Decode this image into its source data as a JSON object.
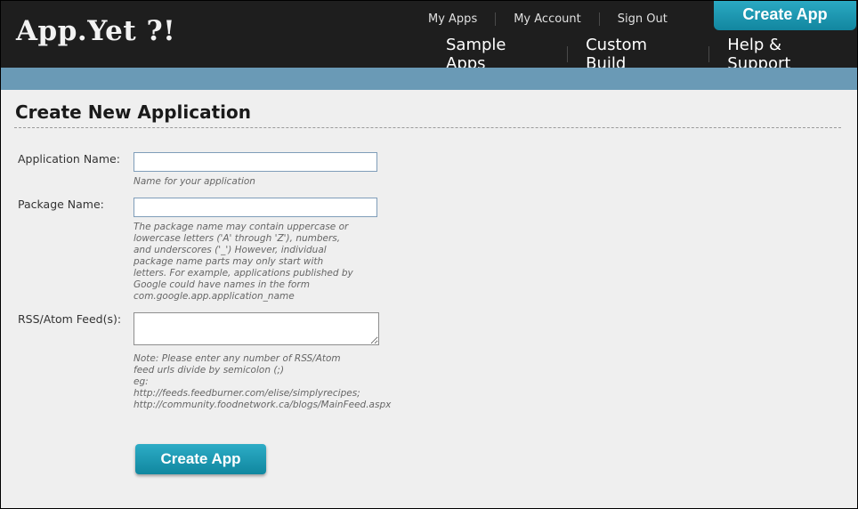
{
  "header": {
    "logo": "App.Yet ?!",
    "top_links": [
      "My Apps",
      "My Account",
      "Sign Out"
    ],
    "create_app_label": "Create App",
    "main_links": [
      "Sample Apps",
      "Custom Build",
      "Help & Support"
    ]
  },
  "page": {
    "title": "Create New Application"
  },
  "form": {
    "app_name": {
      "label": "Application Name:",
      "value": "",
      "hint": "Name for your application"
    },
    "package_name": {
      "label": "Package Name:",
      "value": "",
      "hint": "The package name may contain uppercase or\nlowercase letters ('A' through 'Z'), numbers,\nand underscores ('_') However, individual\npackage name parts may only start with\nletters. For example, applications published by\nGoogle could have names in the form\ncom.google.app.application_name"
    },
    "feeds": {
      "label": "RSS/Atom Feed(s):",
      "value": "",
      "hint": "Note: Please enter any number of RSS/Atom\nfeed urls divide by semicolon (;)\neg:\nhttp://feeds.feedburner.com/elise/simplyrecipes;\nhttp://community.foodnetwork.ca/blogs/MainFeed.aspx"
    },
    "submit_label": "Create App"
  },
  "colors": {
    "header_bg": "#1e1e1e",
    "subbar": "#6a9ab6",
    "accent": "#1a9bb5",
    "page_bg": "#efefef"
  }
}
